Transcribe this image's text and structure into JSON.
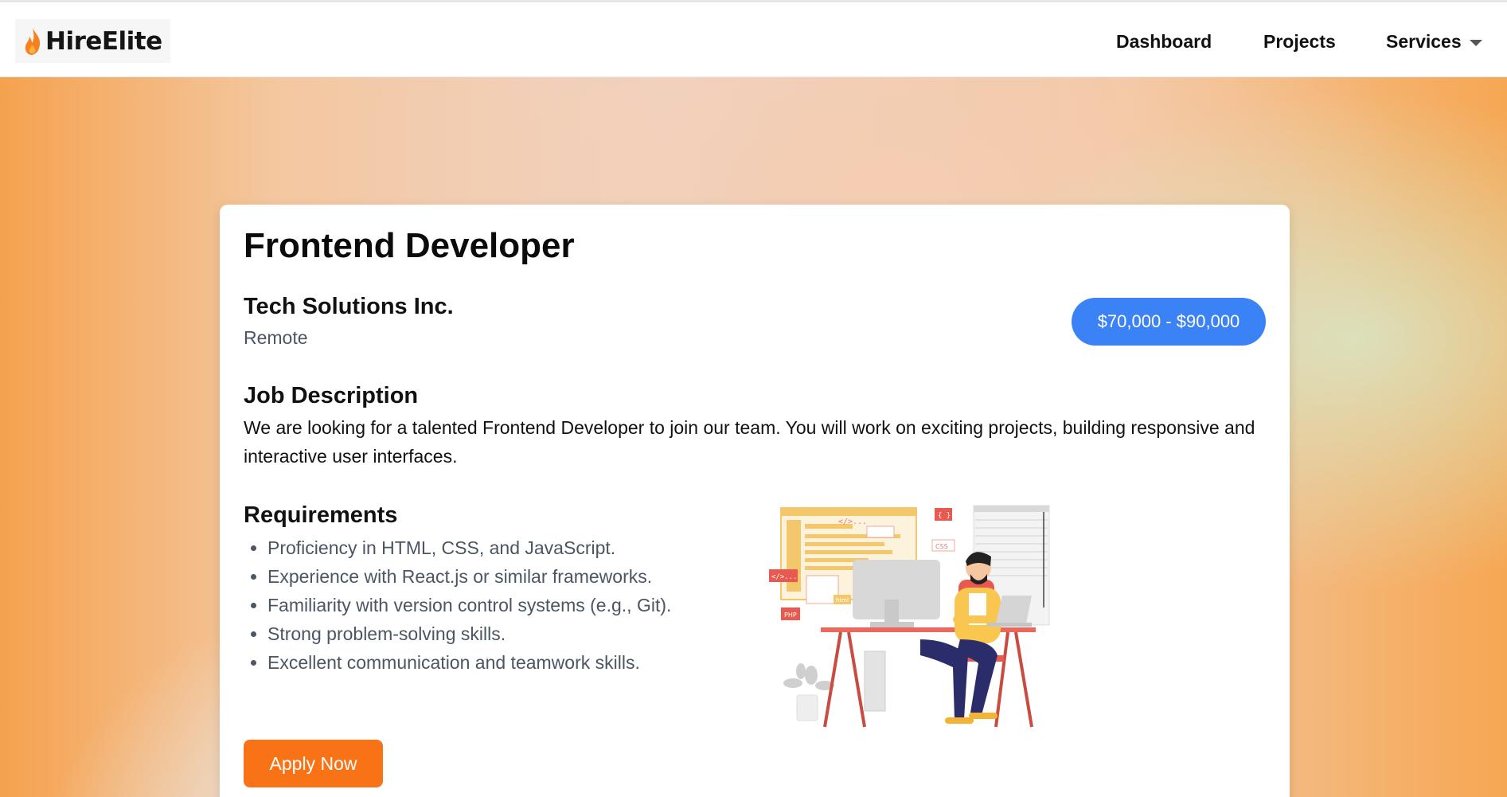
{
  "header": {
    "logo_text": "HireElite",
    "nav": {
      "dashboard": "Dashboard",
      "projects": "Projects",
      "services": "Services"
    }
  },
  "job": {
    "title": "Frontend Developer",
    "company": "Tech Solutions Inc.",
    "location": "Remote",
    "salary": "$70,000 - $90,000",
    "description_heading": "Job Description",
    "description": "We are looking for a talented Frontend Developer to join our team. You will work on exciting projects, building responsive and interactive user interfaces.",
    "requirements_heading": "Requirements",
    "requirements": [
      "Proficiency in HTML, CSS, and JavaScript.",
      "Experience with React.js or similar frameworks.",
      "Familiarity with version control systems (e.g., Git).",
      "Strong problem-solving skills.",
      "Excellent communication and teamwork skills."
    ],
    "apply_label": "Apply Now"
  },
  "colors": {
    "brand_orange": "#f97316",
    "salary_blue": "#3b82f6"
  },
  "illustration": {
    "badges": [
      "</>...",
      "{ }",
      "CSS",
      "</>...",
      "PHP",
      "html"
    ]
  }
}
